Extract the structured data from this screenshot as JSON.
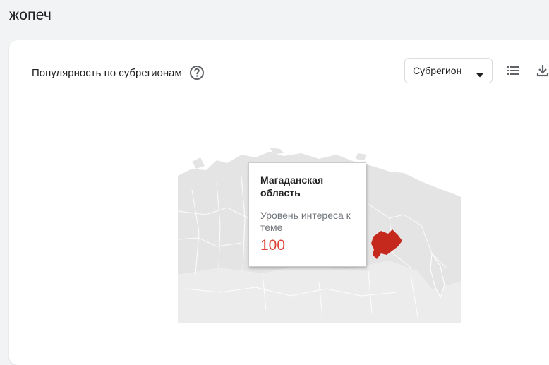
{
  "page": {
    "title": "жопеч"
  },
  "card": {
    "title": "Популярность по субрегионам",
    "help_icon": "help-circle-icon",
    "region_select": {
      "selected": "Субрегион"
    },
    "list_icon": "list-view-icon",
    "download_icon": "download-icon"
  },
  "map": {
    "highlight_color": "#c5281c",
    "land_color": "#e0e0e0",
    "tooltip": {
      "region": "Магаданская область",
      "interest_label": "Уровень интереса к теме",
      "value": "100"
    }
  }
}
